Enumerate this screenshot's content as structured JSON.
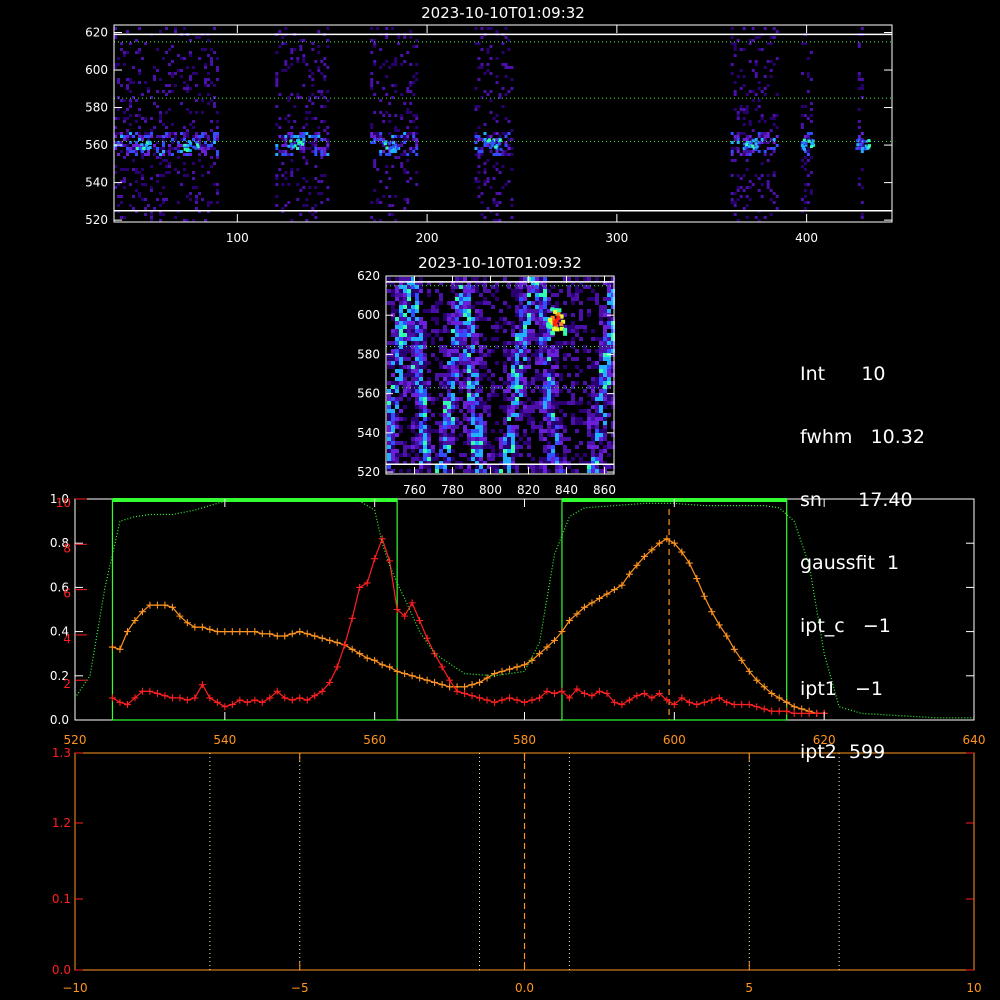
{
  "chart_data": [
    {
      "type": "heatmap",
      "title": "2023-10-10T01:09:32",
      "xlim": [
        35,
        445
      ],
      "ylim": [
        519,
        624
      ],
      "xticks": [
        100,
        200,
        300,
        400
      ],
      "yticks": [
        520,
        540,
        560,
        580,
        600,
        620
      ],
      "white_lines_y": [
        525,
        619
      ],
      "green_dotted_y": [
        562,
        585,
        615
      ],
      "column_bands": [
        [
          35,
          90
        ],
        [
          120,
          148
        ],
        [
          170,
          195
        ],
        [
          225,
          245
        ],
        [
          360,
          385
        ],
        [
          397,
          403
        ],
        [
          427,
          430
        ]
      ],
      "bright_cores": [
        [
          50,
          560
        ],
        [
          75,
          560
        ],
        [
          130,
          561
        ],
        [
          180,
          560
        ],
        [
          235,
          561
        ],
        [
          370,
          561
        ],
        [
          400,
          561
        ],
        [
          429,
          561
        ]
      ]
    },
    {
      "type": "heatmap",
      "title": "2023-10-10T01:09:32",
      "xlim": [
        745,
        865
      ],
      "ylim": [
        519,
        620
      ],
      "xticks": [
        760,
        780,
        800,
        820,
        840,
        860
      ],
      "yticks": [
        520,
        540,
        560,
        580,
        600,
        620
      ],
      "white_lines_y": [
        524,
        617
      ],
      "green_dotted_y": [
        563,
        584,
        615
      ],
      "streak_x": [
        748,
        762,
        778,
        790,
        812,
        830,
        858
      ],
      "hotspot": [
        834,
        598
      ]
    },
    {
      "type": "line",
      "xlim": [
        520,
        640
      ],
      "ylim": [
        0,
        1.0
      ],
      "xticks": [
        520,
        540,
        560,
        580,
        600,
        620,
        640
      ],
      "yticks_left": [
        0.0,
        0.2,
        0.4,
        0.6,
        0.8,
        1.0
      ],
      "yticks_right": [
        0.2,
        0.4,
        0.6,
        0.8
      ],
      "red_axis_labels": [
        "2",
        "4",
        "6",
        "8",
        "10"
      ],
      "red_axis_values": [
        0.18,
        0.385,
        0.59,
        0.795,
        1.0
      ],
      "green_boxes": [
        [
          525,
          563
        ],
        [
          585,
          615
        ]
      ],
      "vline_x": 599.3,
      "vline_top": 1.0,
      "series": [
        {
          "color": "#ff9520",
          "x": [
            525,
            526,
            527,
            528,
            529,
            530,
            531,
            532,
            533,
            534,
            535,
            536,
            537,
            538,
            539,
            540,
            541,
            542,
            543,
            544,
            545,
            546,
            547,
            548,
            549,
            550,
            551,
            552,
            553,
            554,
            555,
            556,
            557,
            558,
            559,
            560,
            561,
            562,
            563,
            564,
            565,
            566,
            567,
            568,
            569,
            570,
            571,
            572,
            573,
            574,
            575,
            576,
            577,
            578,
            579,
            580,
            581,
            582,
            583,
            584,
            585,
            586,
            587,
            588,
            589,
            590,
            591,
            592,
            593,
            594,
            595,
            596,
            597,
            598,
            599,
            600,
            601,
            602,
            603,
            604,
            605,
            606,
            607,
            608,
            609,
            610,
            611,
            612,
            613,
            614,
            615,
            616,
            617,
            618,
            619,
            620
          ],
          "y": [
            0.33,
            0.32,
            0.4,
            0.45,
            0.49,
            0.52,
            0.52,
            0.52,
            0.51,
            0.47,
            0.44,
            0.42,
            0.42,
            0.41,
            0.4,
            0.4,
            0.4,
            0.4,
            0.4,
            0.4,
            0.39,
            0.39,
            0.38,
            0.38,
            0.39,
            0.4,
            0.39,
            0.38,
            0.37,
            0.36,
            0.35,
            0.34,
            0.32,
            0.3,
            0.28,
            0.27,
            0.25,
            0.24,
            0.22,
            0.21,
            0.2,
            0.19,
            0.18,
            0.17,
            0.16,
            0.15,
            0.15,
            0.15,
            0.16,
            0.17,
            0.19,
            0.21,
            0.22,
            0.23,
            0.24,
            0.25,
            0.27,
            0.3,
            0.33,
            0.36,
            0.4,
            0.45,
            0.48,
            0.51,
            0.53,
            0.55,
            0.57,
            0.59,
            0.61,
            0.66,
            0.7,
            0.74,
            0.77,
            0.8,
            0.82,
            0.8,
            0.76,
            0.71,
            0.64,
            0.56,
            0.49,
            0.43,
            0.38,
            0.32,
            0.27,
            0.22,
            0.18,
            0.15,
            0.12,
            0.1,
            0.08,
            0.06,
            0.05,
            0.04,
            0.03,
            0.03
          ]
        },
        {
          "color": "#ff2020",
          "x": [
            525,
            526,
            527,
            528,
            529,
            530,
            531,
            532,
            533,
            534,
            535,
            536,
            537,
            538,
            539,
            540,
            541,
            542,
            543,
            544,
            545,
            546,
            547,
            548,
            549,
            550,
            551,
            552,
            553,
            554,
            555,
            556,
            557,
            558,
            559,
            560,
            561,
            562,
            563,
            564,
            565,
            566,
            567,
            568,
            569,
            570,
            571,
            572,
            573,
            574,
            575,
            576,
            577,
            578,
            579,
            580,
            581,
            582,
            583,
            584,
            585,
            586,
            587,
            588,
            589,
            590,
            591,
            592,
            593,
            594,
            595,
            596,
            597,
            598,
            599,
            600,
            601,
            602,
            603,
            604,
            605,
            606,
            607,
            608,
            609,
            610,
            611,
            612,
            613,
            614,
            615,
            616,
            617,
            618,
            619,
            620
          ],
          "y": [
            0.1,
            0.08,
            0.07,
            0.1,
            0.13,
            0.13,
            0.12,
            0.11,
            0.1,
            0.1,
            0.09,
            0.1,
            0.16,
            0.1,
            0.08,
            0.06,
            0.07,
            0.09,
            0.08,
            0.09,
            0.08,
            0.1,
            0.13,
            0.1,
            0.09,
            0.1,
            0.09,
            0.11,
            0.13,
            0.17,
            0.24,
            0.34,
            0.46,
            0.6,
            0.62,
            0.73,
            0.82,
            0.72,
            0.5,
            0.47,
            0.53,
            0.45,
            0.37,
            0.3,
            0.24,
            0.18,
            0.13,
            0.12,
            0.11,
            0.1,
            0.09,
            0.08,
            0.09,
            0.1,
            0.09,
            0.08,
            0.09,
            0.1,
            0.13,
            0.12,
            0.13,
            0.1,
            0.14,
            0.12,
            0.11,
            0.13,
            0.12,
            0.08,
            0.07,
            0.09,
            0.11,
            0.12,
            0.1,
            0.12,
            0.09,
            0.07,
            0.1,
            0.08,
            0.07,
            0.08,
            0.09,
            0.1,
            0.08,
            0.07,
            0.07,
            0.07,
            0.06,
            0.05,
            0.04,
            0.04,
            0.04,
            0.03,
            0.03,
            0.03,
            0.03,
            0.03
          ]
        },
        {
          "color": "#33ff33",
          "style": "dotted",
          "x": [
            520,
            522,
            524,
            526,
            528,
            530,
            533,
            536,
            540,
            545,
            550,
            555,
            558,
            560,
            561,
            562,
            563,
            564,
            566,
            568,
            572,
            576,
            580,
            582,
            584,
            586,
            588,
            592,
            596,
            600,
            604,
            608,
            612,
            614,
            616,
            618,
            620,
            622,
            625,
            630,
            635,
            640
          ],
          "y": [
            0.1,
            0.2,
            0.6,
            0.9,
            0.92,
            0.93,
            0.93,
            0.95,
            0.99,
            1.0,
            1.0,
            0.99,
            0.99,
            0.95,
            0.8,
            0.7,
            0.62,
            0.55,
            0.4,
            0.3,
            0.21,
            0.2,
            0.22,
            0.35,
            0.75,
            0.92,
            0.96,
            0.97,
            0.98,
            0.98,
            0.97,
            0.97,
            0.97,
            0.96,
            0.9,
            0.7,
            0.3,
            0.06,
            0.03,
            0.02,
            0.01,
            0.01
          ]
        }
      ]
    },
    {
      "type": "line",
      "xlim": [
        -10,
        10
      ],
      "ylim": [
        0.0,
        1.3
      ],
      "xticks": [
        -10,
        -5,
        0,
        5,
        10
      ],
      "yticks": [
        0.0,
        0.1,
        1.2,
        1.3
      ],
      "dotted_vlines_x": [
        -7,
        -5,
        -1,
        1,
        5,
        7
      ],
      "dashed_vline_x": 0,
      "series": []
    }
  ],
  "info": {
    "line1": "Int      10",
    "line2": "fwhm   10.32",
    "line3": "sn      17.40",
    "line4": "gaussfit  1",
    "line5": "ipt_c   −1",
    "line6": "ipt1   −1",
    "line7": "ipt2  599"
  }
}
